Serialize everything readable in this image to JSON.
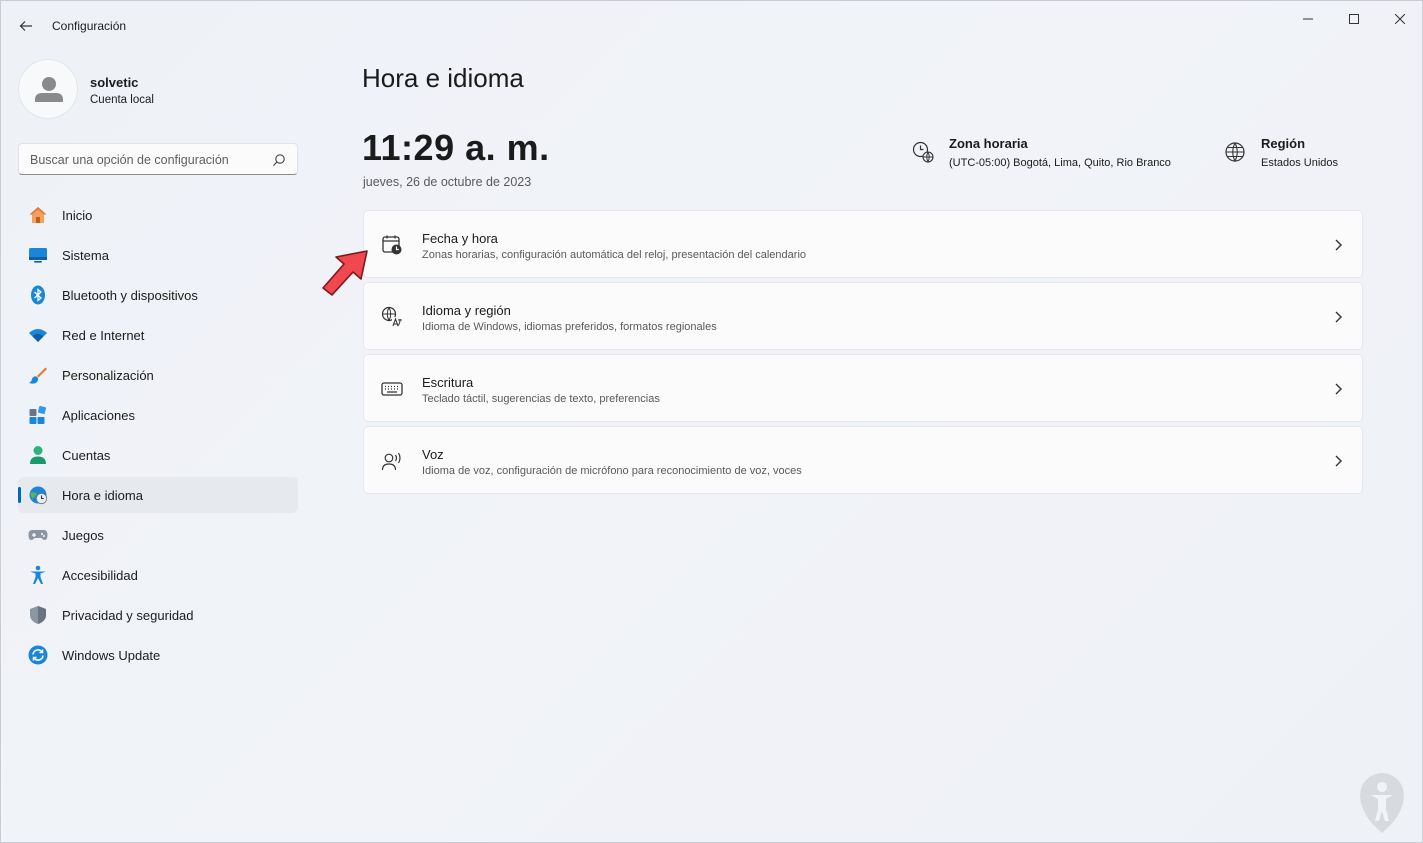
{
  "app": {
    "title": "Configuración"
  },
  "profile": {
    "name": "solvetic",
    "account_type": "Cuenta local"
  },
  "search": {
    "placeholder": "Buscar una opción de configuración"
  },
  "sidebar": {
    "items": [
      {
        "label": "Inicio",
        "icon": "home-icon"
      },
      {
        "label": "Sistema",
        "icon": "monitor-icon"
      },
      {
        "label": "Bluetooth y dispositivos",
        "icon": "bluetooth-icon"
      },
      {
        "label": "Red e Internet",
        "icon": "wifi-icon"
      },
      {
        "label": "Personalización",
        "icon": "brush-icon"
      },
      {
        "label": "Aplicaciones",
        "icon": "apps-icon"
      },
      {
        "label": "Cuentas",
        "icon": "person-icon"
      },
      {
        "label": "Hora e idioma",
        "icon": "clock-globe-icon",
        "active": true
      },
      {
        "label": "Juegos",
        "icon": "gamepad-icon"
      },
      {
        "label": "Accesibilidad",
        "icon": "accessibility-icon"
      },
      {
        "label": "Privacidad y seguridad",
        "icon": "shield-icon"
      },
      {
        "label": "Windows Update",
        "icon": "update-icon"
      }
    ]
  },
  "main": {
    "title": "Hora e idioma",
    "time": "11:29 a. m.",
    "date": "jueves, 26 de octubre de 2023",
    "timezone": {
      "title": "Zona horaria",
      "value": "(UTC-05:00) Bogotá, Lima, Quito, Rio Branco"
    },
    "region": {
      "title": "Región",
      "value": "Estados Unidos"
    },
    "cards": [
      {
        "title": "Fecha y hora",
        "desc": "Zonas horarias, configuración automática del reloj, presentación del calendario",
        "icon": "calendar-clock-icon"
      },
      {
        "title": "Idioma y región",
        "desc": "Idioma de Windows, idiomas preferidos, formatos regionales",
        "icon": "language-icon"
      },
      {
        "title": "Escritura",
        "desc": "Teclado táctil, sugerencias de texto, preferencias",
        "icon": "keyboard-icon"
      },
      {
        "title": "Voz",
        "desc": "Idioma de voz, configuración de micrófono para reconocimiento de voz, voces",
        "icon": "speech-icon"
      }
    ]
  },
  "colors": {
    "accent": "#0067c0",
    "annotation_arrow": "#f0484e"
  }
}
